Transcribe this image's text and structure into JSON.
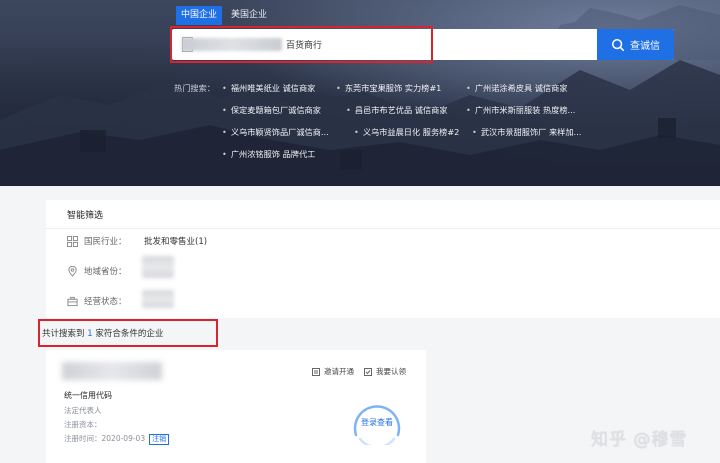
{
  "tabs": [
    {
      "label": "中国企业",
      "active": true
    },
    {
      "label": "美国企业",
      "active": false
    }
  ],
  "search": {
    "value_suffix": "百货商行",
    "button_label": "查诚信"
  },
  "hot_search": {
    "label": "热门搜索：",
    "items": [
      "福州唯美纸业 诚信商家",
      "东莞市宝果服饰 实力榜#1",
      "广州诺涂希皮具 诚信商家",
      "保定麦题箱包厂诚信商家",
      "昌邑市布艺优品 诚信商家",
      "广州市米斯丽服装 热度榜...",
      "义乌市颖贤饰品厂诚信商...",
      "义乌市益晨日化 服务榜#2",
      "武汉市景甜服饰厂 来样加...",
      "广州浓铭服饰 品牌代工"
    ]
  },
  "filters": {
    "title": "智能筛选",
    "industry_label": "国民行业：",
    "industry_value": "批发和零售业(1)",
    "region_label": "地域省份：",
    "status_label": "经营状态："
  },
  "result": {
    "prefix": "共计搜索到 ",
    "count": "1",
    "suffix": " 家符合条件的企业"
  },
  "card": {
    "credit_code_label": "统一信用代码",
    "legal_rep_label": "法定代表人",
    "reg_capital_label": "注册资本：",
    "reg_time": "注册时间：2020-09-03",
    "badge": "注销",
    "invite_label": "邀请开通",
    "claim_label": "我要认领",
    "login_label": "登录查看"
  },
  "watermark": "知乎 @穆雪",
  "colors": {
    "accent": "#1f6fe5",
    "highlight_border": "#d7242f"
  }
}
